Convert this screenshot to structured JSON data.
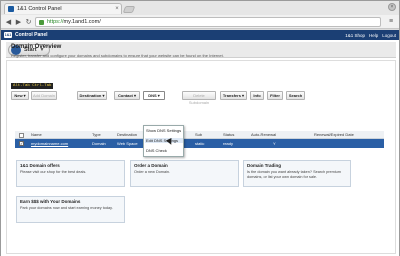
{
  "browser": {
    "tab_title": "1&1 Control Panel",
    "tab_close": "×",
    "url_scheme": "https://",
    "url_host": "my.1and1.com",
    "url_path": "/",
    "back_glyph": "◀",
    "forward_glyph": "▶",
    "reload_glyph": "↻",
    "menu_glyph": "≡",
    "window_close": "×"
  },
  "control_panel": {
    "logo_text": "1&1",
    "title": "Control Panel",
    "top_links": [
      "1&1 Shop",
      "Help",
      "Logout"
    ]
  },
  "start": {
    "label": "Start",
    "chevron": "▼"
  },
  "overview": {
    "title": "Domain Overview",
    "description": "Register, transfer and configure your domains and subdomains to ensure that your website can be found on the Internet."
  },
  "shortcut_hint": "Alt-Tab Ctrl-Tab",
  "toolbar": {
    "buttons": [
      {
        "label": "New ▾",
        "disabled": false
      },
      {
        "label": "Add Domain",
        "disabled": true
      },
      {
        "label": "Destination ▾",
        "disabled": false
      },
      {
        "label": "Contact ▾",
        "disabled": false
      },
      {
        "label": "DNS ▾",
        "disabled": false,
        "active": true
      },
      {
        "label": "Delete Subdomain",
        "disabled": true
      },
      {
        "label": "Transfers ▾",
        "disabled": false
      },
      {
        "label": "Info",
        "disabled": false
      },
      {
        "label": "Filter",
        "disabled": false
      },
      {
        "label": "Search",
        "disabled": false
      }
    ]
  },
  "dns_menu": {
    "items": [
      "Show DNS Settings",
      "Edit DNS Settings",
      "DNS Check"
    ]
  },
  "table": {
    "headers": [
      "Name",
      "Type",
      "Destination",
      "Sub",
      "Status",
      "Auto-Renewal",
      "Renewal/Expired Date"
    ],
    "rows": [
      {
        "name": "mydomainname.com",
        "type": "Domain",
        "destination": "Web Space",
        "sub": "static",
        "status": "ready",
        "auto_renewal": "Y",
        "renewal": ""
      }
    ]
  },
  "cards": [
    {
      "title": "1&1 Domain offers",
      "text": "Please visit our shop for the best deals."
    },
    {
      "title": "Order a Domain",
      "text": "Order a new Domain."
    },
    {
      "title": "Domain Trading",
      "text": "Is the domain you want already taken? Search premium domains, or list your own domain for sale."
    },
    {
      "title": "Earn $$$ with Your Domains",
      "text": "Park your domains now and start earning money today."
    }
  ],
  "colors": {
    "header_blue": "#1b3f74",
    "selected_row": "#2a5fa5"
  }
}
